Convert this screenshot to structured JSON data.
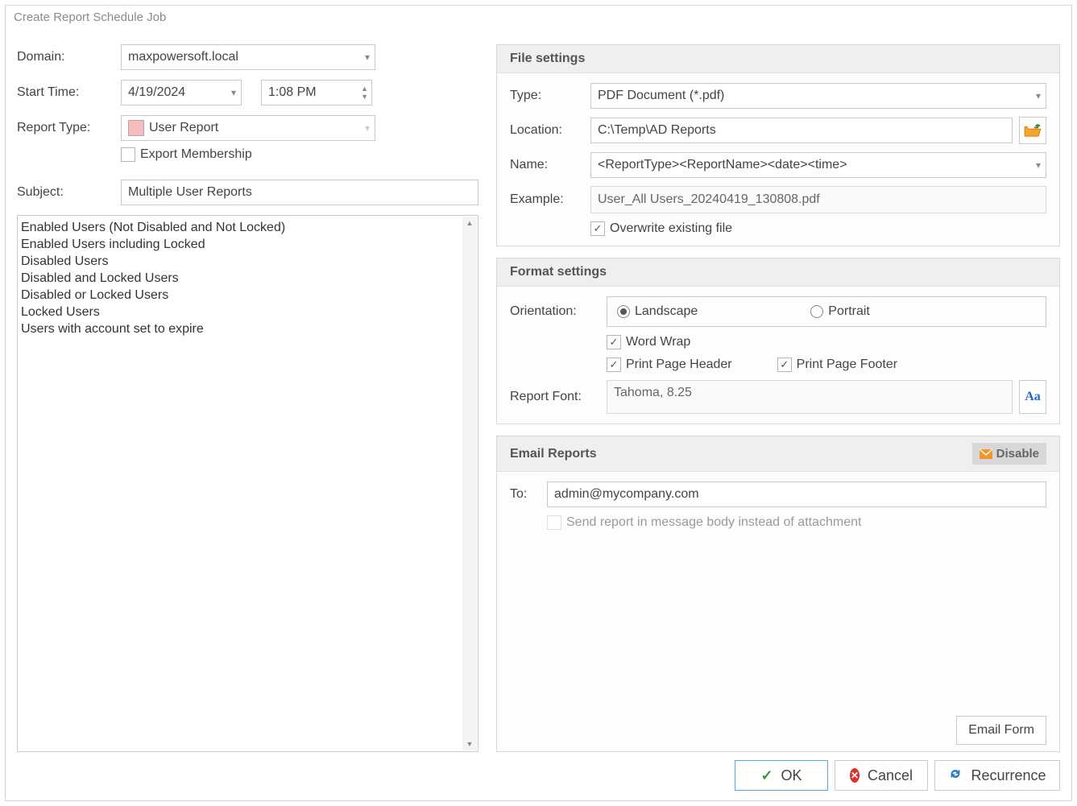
{
  "title": "Create Report Schedule Job",
  "left": {
    "domain_label": "Domain:",
    "domain_value": "maxpowersoft.local",
    "start_label": "Start Time:",
    "date_value": "4/19/2024",
    "time_value": "1:08 PM",
    "rtype_label": "Report Type:",
    "rtype_value": "User Report",
    "export_mem": "Export Membership",
    "subject_label": "Subject:",
    "subject_value": "Multiple User Reports",
    "list": [
      "Enabled Users (Not Disabled and Not Locked)",
      "Enabled Users including Locked",
      "Disabled Users",
      "Disabled and Locked Users",
      "Disabled or Locked Users",
      "Locked Users",
      "Users with account set to expire"
    ]
  },
  "file": {
    "header": "File settings",
    "type_label": "Type:",
    "type_value": "PDF Document (*.pdf)",
    "loc_label": "Location:",
    "loc_value": "C:\\Temp\\AD Reports",
    "name_label": "Name:",
    "name_value": "<ReportType><ReportName><date><time>",
    "example_label": "Example:",
    "example_value": "User_All Users_20240419_130808.pdf",
    "overwrite": "Overwrite existing file"
  },
  "format": {
    "header": "Format settings",
    "orient_label": "Orientation:",
    "landscape": "Landscape",
    "portrait": "Portrait",
    "wrap": "Word Wrap",
    "pph": "Print Page Header",
    "ppf": "Print Page Footer",
    "font_label": "Report Font:",
    "font_value": "Tahoma, 8.25"
  },
  "email": {
    "header": "Email Reports",
    "disable": "Disable",
    "to_label": "To:",
    "to_value": "admin@mycompany.com",
    "body_opt": "Send report in message body instead of attachment",
    "form_btn": "Email Form"
  },
  "buttons": {
    "ok": "OK",
    "cancel": "Cancel",
    "recurrence": "Recurrence"
  }
}
